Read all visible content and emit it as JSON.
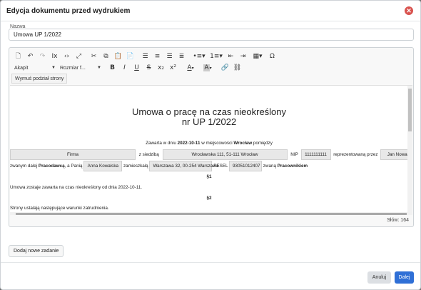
{
  "dialog": {
    "title": "Edycja dokumentu przed wydrukiem",
    "close_icon": "close-icon"
  },
  "name": {
    "label": "Nazwa",
    "value": "Umowa UP 1/2022"
  },
  "toolbar": {
    "row1_icons": [
      "new-document-icon",
      "undo-icon",
      "redo-icon",
      "clear-format-icon",
      "source-code-icon",
      "fullscreen-icon",
      "cut-icon",
      "copy-icon",
      "paste-icon",
      "paste-text-icon",
      "align-left-icon",
      "align-center-icon",
      "align-right-icon",
      "align-justify-icon",
      "bullet-list-icon",
      "numbered-list-icon",
      "outdent-icon",
      "indent-icon",
      "table-icon",
      "special-char-icon"
    ],
    "paragraph_select": "Akapit",
    "font_size_select": "Rozmiar f...",
    "bold": "B",
    "italic": "I",
    "underline": "U",
    "strike": "S",
    "subscript": "x₂",
    "superscript": "x²",
    "text_color": "A",
    "bg_color": "A",
    "force_page_break": "Wymuś podział strony"
  },
  "document": {
    "title_line1": "Umowa o pracę na czas nieokreślony",
    "title_line2": "nr UP 1/2022",
    "concluded_prefix": "Zawarta w dniu ",
    "concluded_date": "2022-10-11",
    "concluded_mid": " w miejscowości ",
    "concluded_city": "Wrocław",
    "concluded_suffix": " pomiędzy",
    "company_field": "Firma",
    "seat_text": "z siedzibą",
    "address_field": "Wrocławska 111, 51-111 Wrocław",
    "nip_label": "NIP",
    "nip_field": "1111111111",
    "represented_text": "reprezentowaną przez",
    "representative_field": "Jan Nowak",
    "called_prefix": "zwanym dalej ",
    "employer_word": "Pracodawcą",
    "and_text": ", a Panią",
    "employee_field": "Anna Kowalska",
    "residing_text": "zamieszkałą",
    "employee_address_field": "Warszawa 32, 00-254 Warszawa",
    "pesel_label": "PESEL",
    "pesel_field": "93051012407",
    "called2_prefix": "zwaną ",
    "employee_word": "Pracownikiem",
    "section1": "§1",
    "section1_text": "Umowa zostaje zawarta na czas nieokreślony od dnia 2022-10-11.",
    "section2": "§2",
    "section2_text": "Strony ustalają następujące warunki zatrudnienia."
  },
  "word_count": "Słów: 164",
  "add_task_button": "Dodaj nowe zadanie",
  "footer": {
    "cancel": "Anuluj",
    "next": "Dalej"
  },
  "colors": {
    "primary": "#2f6fd6",
    "danger": "#d9534f"
  }
}
